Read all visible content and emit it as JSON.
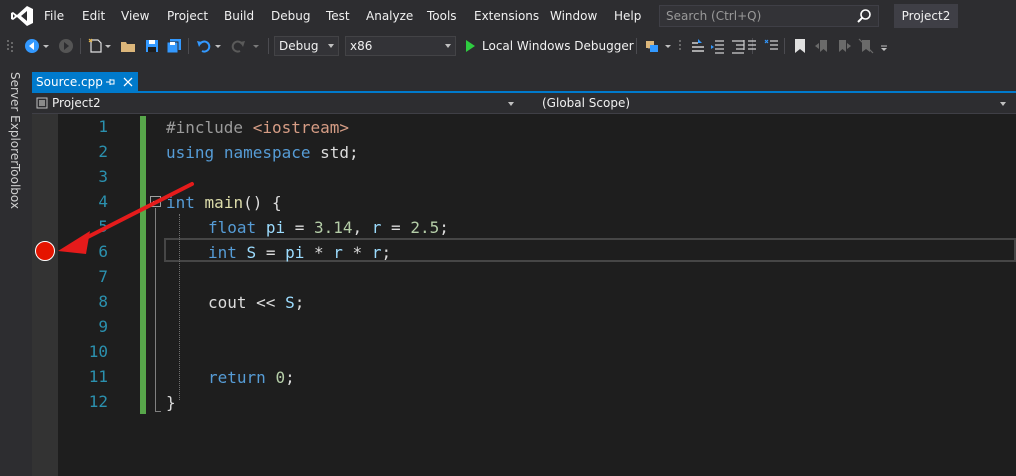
{
  "menu": {
    "items": [
      "File",
      "Edit",
      "View",
      "Project",
      "Build",
      "Debug",
      "Test",
      "Analyze",
      "Tools",
      "Extensions",
      "Window",
      "Help"
    ],
    "search_placeholder": "Search (Ctrl+Q)",
    "project_title": "Project2"
  },
  "toolbar": {
    "configuration": "Debug",
    "platform": "x86",
    "run_label": "Local Windows Debugger"
  },
  "side_tabs": [
    "Server Explorer",
    "Toolbox"
  ],
  "document_tab": {
    "label": "Source.cpp",
    "pin_glyph": "⊣",
    "close_glyph": "✕"
  },
  "navbar": {
    "project": "Project2",
    "scope": "(Global Scope)"
  },
  "editor": {
    "line_numbers": [
      "1",
      "2",
      "3",
      "4",
      "5",
      "6",
      "7",
      "8",
      "9",
      "10",
      "11",
      "12"
    ],
    "code": {
      "l1_directive": "#include",
      "l1_header": "<iostream>",
      "l2_using": "using",
      "l2_namespace": "namespace",
      "l2_rest": " std;",
      "l4_int": "int",
      "l4_main": "main",
      "l4_rest": "() {",
      "l5_float": "float",
      "l5_pi": "pi",
      "l5_eq": " = ",
      "l5_val1": "3.14",
      "l5_comma": ", ",
      "l5_r": "r",
      "l5_eq2": " = ",
      "l5_val2": "2.5",
      "l5_semi": ";",
      "l6_int": "int",
      "l6_S": "S",
      "l6_eq": " = ",
      "l6_pi": "pi",
      "l6_star1": " * ",
      "l6_r1": "r",
      "l6_star2": " * ",
      "l6_r2": "r",
      "l6_semi": ";",
      "l8_cout": "cout",
      "l8_op": " << ",
      "l8_S": "S",
      "l8_semi": ";",
      "l11_return": "return",
      "l11_val": "0",
      "l11_semi": ";",
      "l12_brace": "}"
    },
    "breakpoint_line": 6,
    "current_line": 6
  },
  "colors": {
    "accent": "#007acc",
    "breakpoint": "#e51400",
    "annotation_arrow": "#e51b1b",
    "change_bar": "#57a64a",
    "keyword": "#569cd6",
    "line_number": "#2b91af"
  }
}
